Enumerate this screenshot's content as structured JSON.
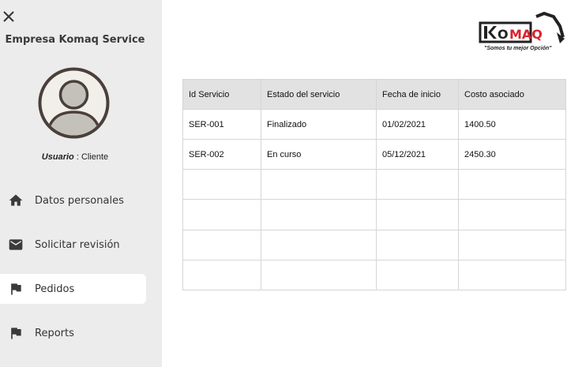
{
  "sidebar": {
    "company_name": "Empresa Komaq Service",
    "role_label": "Usuario",
    "role_separator": " : ",
    "role_value": "Cliente",
    "items": [
      {
        "label": "Datos personales",
        "icon": "home-icon"
      },
      {
        "label": "Solicitar revisión",
        "icon": "mail-icon"
      },
      {
        "label": "Pedidos",
        "icon": "flag-icon",
        "active": true
      },
      {
        "label": "Reports",
        "icon": "flag-icon"
      }
    ]
  },
  "logo": {
    "brand": "KOMAQ",
    "tagline": "\"Somos tu mejor Opción\""
  },
  "table": {
    "headers": [
      "Id Servicio",
      "Estado del servicio",
      "Fecha de inicio",
      "Costo asociado"
    ],
    "rows": [
      [
        "SER-001",
        "Finalizado",
        "01/02/2021",
        "1400.50"
      ],
      [
        "SER-002",
        "En curso",
        "05/12/2021",
        "2450.30"
      ],
      [
        "",
        "",
        "",
        ""
      ],
      [
        "",
        "",
        "",
        ""
      ],
      [
        "",
        "",
        "",
        ""
      ],
      [
        "",
        "",
        "",
        ""
      ]
    ]
  },
  "colors": {
    "sidebar_bg": "#ececec",
    "header_bg": "#e2e2e2",
    "brand_red": "#d9232e",
    "icon_dark": "#3a3a3a"
  }
}
